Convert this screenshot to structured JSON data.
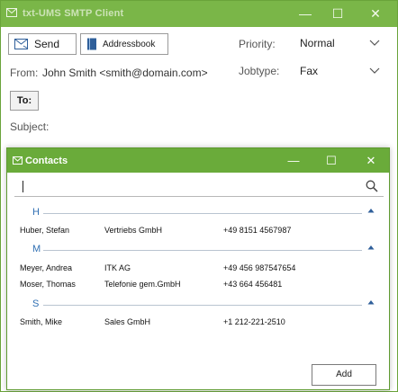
{
  "window": {
    "title": "txt-UMS SMTP Client",
    "minimize_glyph": "—",
    "maximize_glyph": "☐",
    "close_glyph": "✕"
  },
  "toolbar": {
    "send_label": "Send",
    "addressbook_label": "Addressbook"
  },
  "priority": {
    "label": "Priority:",
    "value": "Normal"
  },
  "from": {
    "label": "From:",
    "value": "John Smith <smith@domain.com>"
  },
  "jobtype": {
    "label": "Jobtype:",
    "value": "Fax"
  },
  "to": {
    "button_label": "To:"
  },
  "subject": {
    "label": "Subject:"
  },
  "contacts_dialog": {
    "title": "Contacts",
    "minimize_glyph": "—",
    "maximize_glyph": "☐",
    "close_glyph": "✕",
    "search": {
      "value": ""
    },
    "groups": [
      {
        "letter": "H",
        "contacts": [
          {
            "name": "Huber, Stefan",
            "company": "Vertriebs GmbH",
            "phone": "+49 8151 4567987"
          }
        ]
      },
      {
        "letter": "M",
        "contacts": [
          {
            "name": "Meyer, Andrea",
            "company": "ITK AG",
            "phone": "+49 456 987547654"
          },
          {
            "name": "Moser, Thomas",
            "company": "Telefonie gem.GmbH",
            "phone": "+43 664 456481"
          }
        ]
      },
      {
        "letter": "S",
        "contacts": [
          {
            "name": "Smith, Mike",
            "company": "Sales GmbH",
            "phone": "+1 212-221-2510"
          }
        ]
      }
    ],
    "add_label": "Add"
  },
  "colors": {
    "title_green": "#7ab648",
    "dialog_green": "#6aab3a",
    "group_blue": "#2f6fb3"
  },
  "icons": [
    "envelope-icon",
    "send-icon",
    "addressbook-icon",
    "chevron-down-icon",
    "search-icon",
    "chevron-up-icon"
  ]
}
